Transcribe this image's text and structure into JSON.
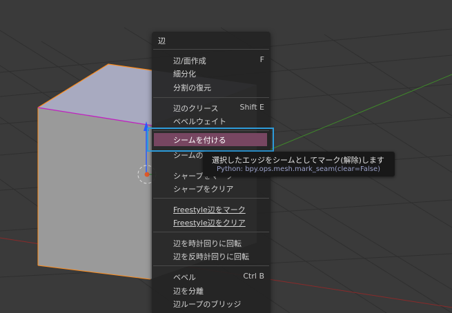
{
  "menu": {
    "title": "辺",
    "items": [
      {
        "label": "辺/面作成",
        "shortcut": "F"
      },
      {
        "label": "細分化",
        "shortcut": ""
      },
      {
        "label": "分割の復元",
        "shortcut": ""
      },
      {
        "label": "辺のクリース",
        "shortcut": "Shift E"
      },
      {
        "label": "ベベルウェイト",
        "shortcut": ""
      },
      {
        "label": "シームを付ける",
        "shortcut": ""
      },
      {
        "label": "シームのクリア",
        "shortcut": ""
      },
      {
        "label": "シャープをマーク",
        "shortcut": ""
      },
      {
        "label": "シャープをクリア",
        "shortcut": ""
      },
      {
        "label": "Freestyle辺をマーク",
        "shortcut": ""
      },
      {
        "label": "Freestyle辺をクリア",
        "shortcut": ""
      },
      {
        "label": "辺を時計回りに回転",
        "shortcut": ""
      },
      {
        "label": "辺を反時計回りに回転",
        "shortcut": ""
      },
      {
        "label": "ベベル",
        "shortcut": "Ctrl B"
      },
      {
        "label": "辺を分離",
        "shortcut": ""
      },
      {
        "label": "辺ループのブリッジ",
        "shortcut": ""
      }
    ]
  },
  "tooltip": {
    "description": "選択したエッジをシームとしてマーク(解除)します",
    "python": "Python: bpy.ops.mesh.mark_seam(clear=False)"
  },
  "colors": {
    "viewport_bg": "#3a3a3a",
    "menu_bg": "#242424",
    "highlight": "#774661",
    "focus_outline": "#2d9cdb",
    "cube_face": "#9a9a9a",
    "cube_top": "#a8aac0",
    "selected_edge": "#ff8c1a",
    "seam_edge": "#c020c0"
  }
}
